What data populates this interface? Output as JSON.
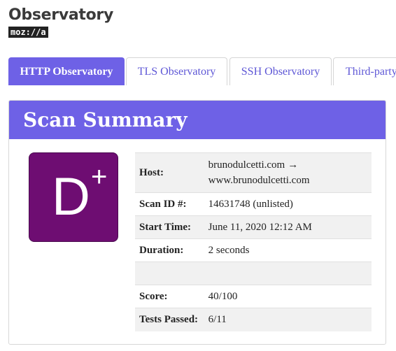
{
  "brand": {
    "title": "Observatory",
    "logo": "moz://a"
  },
  "tabs": [
    {
      "label": "HTTP Observatory",
      "active": true
    },
    {
      "label": "TLS Observatory",
      "active": false
    },
    {
      "label": "SSH Observatory",
      "active": false
    },
    {
      "label": "Third-party",
      "active": false
    }
  ],
  "summary": {
    "heading": "Scan Summary",
    "grade": {
      "letter": "D",
      "modifier": "+"
    },
    "rows": {
      "host": {
        "label": "Host:",
        "value": "brunodulcetti.com",
        "arrow": "→",
        "redirect": "www.brunodulcetti.com"
      },
      "scan_id": {
        "label": "Scan ID #:",
        "value": "14631748 (unlisted)"
      },
      "start_time": {
        "label": "Start Time:",
        "value": "June 11, 2020 12:12 AM"
      },
      "duration": {
        "label": "Duration:",
        "value": "2 seconds"
      },
      "score": {
        "label": "Score:",
        "value": "40/100"
      },
      "tests_passed": {
        "label": "Tests Passed:",
        "value": "6/11"
      }
    }
  },
  "colors": {
    "accent": "#6e61e6",
    "grade_d": "#6e0d72",
    "tab_text": "#5e57d6"
  }
}
